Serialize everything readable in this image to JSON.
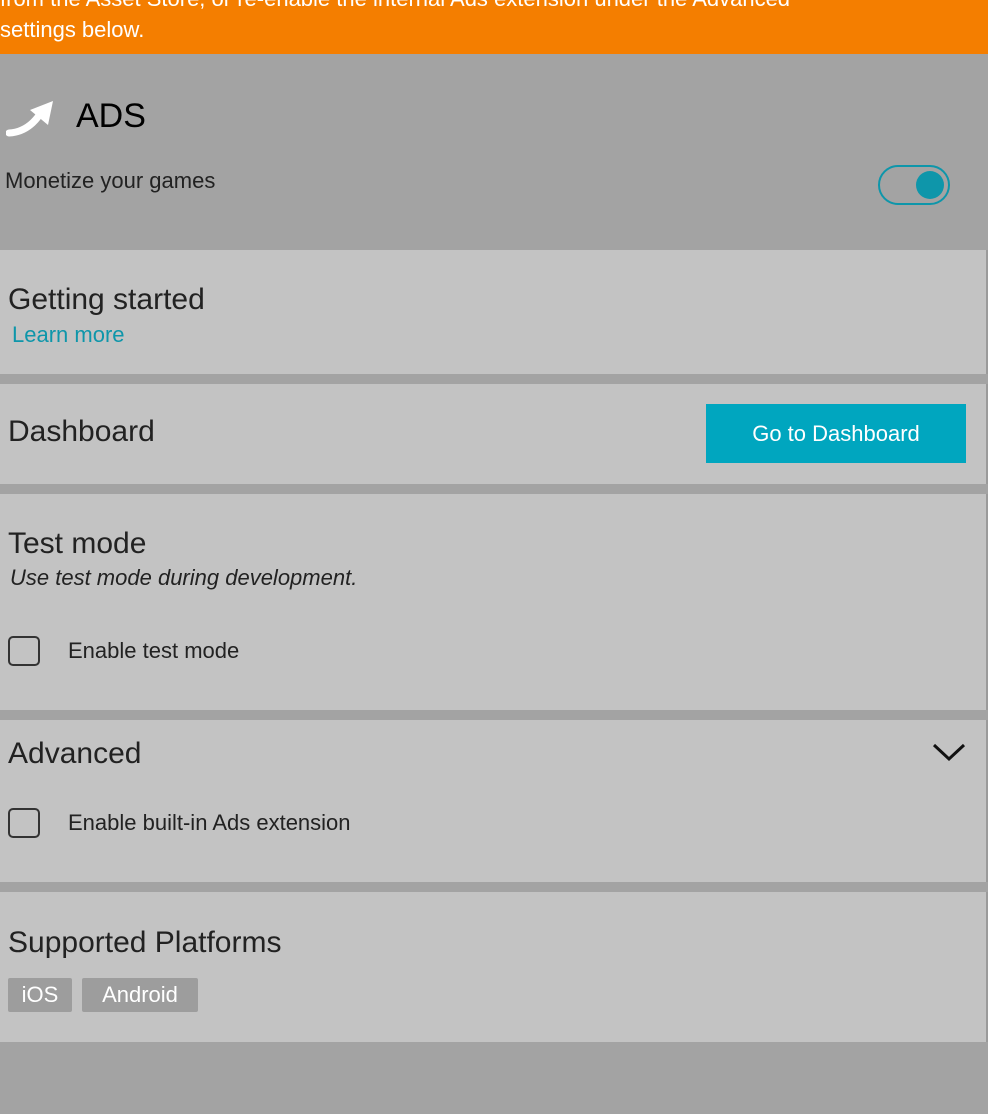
{
  "banner": {
    "line1": "from the Asset Store, or re-enable the internal Ads extension under the Advanced",
    "line2": "settings below.",
    "color": "#f47e00"
  },
  "service": {
    "title": "ADS",
    "subtitle": "Monetize your games",
    "enabled": true,
    "icon": "arrow-curve-icon",
    "accent_color": "#0e96aa"
  },
  "getting_started": {
    "title": "Getting started",
    "link": "Learn more"
  },
  "dashboard": {
    "title": "Dashboard",
    "button_label": "Go to Dashboard"
  },
  "test_mode": {
    "title": "Test mode",
    "description": "Use test mode during development.",
    "checkbox_label": "Enable test mode",
    "checked": false
  },
  "advanced": {
    "title": "Advanced",
    "expand_icon": "chevron-down-icon",
    "checkbox_label": "Enable built-in Ads extension",
    "checked": false
  },
  "platforms": {
    "title": "Supported Platforms",
    "items": [
      "iOS",
      "Android"
    ]
  }
}
